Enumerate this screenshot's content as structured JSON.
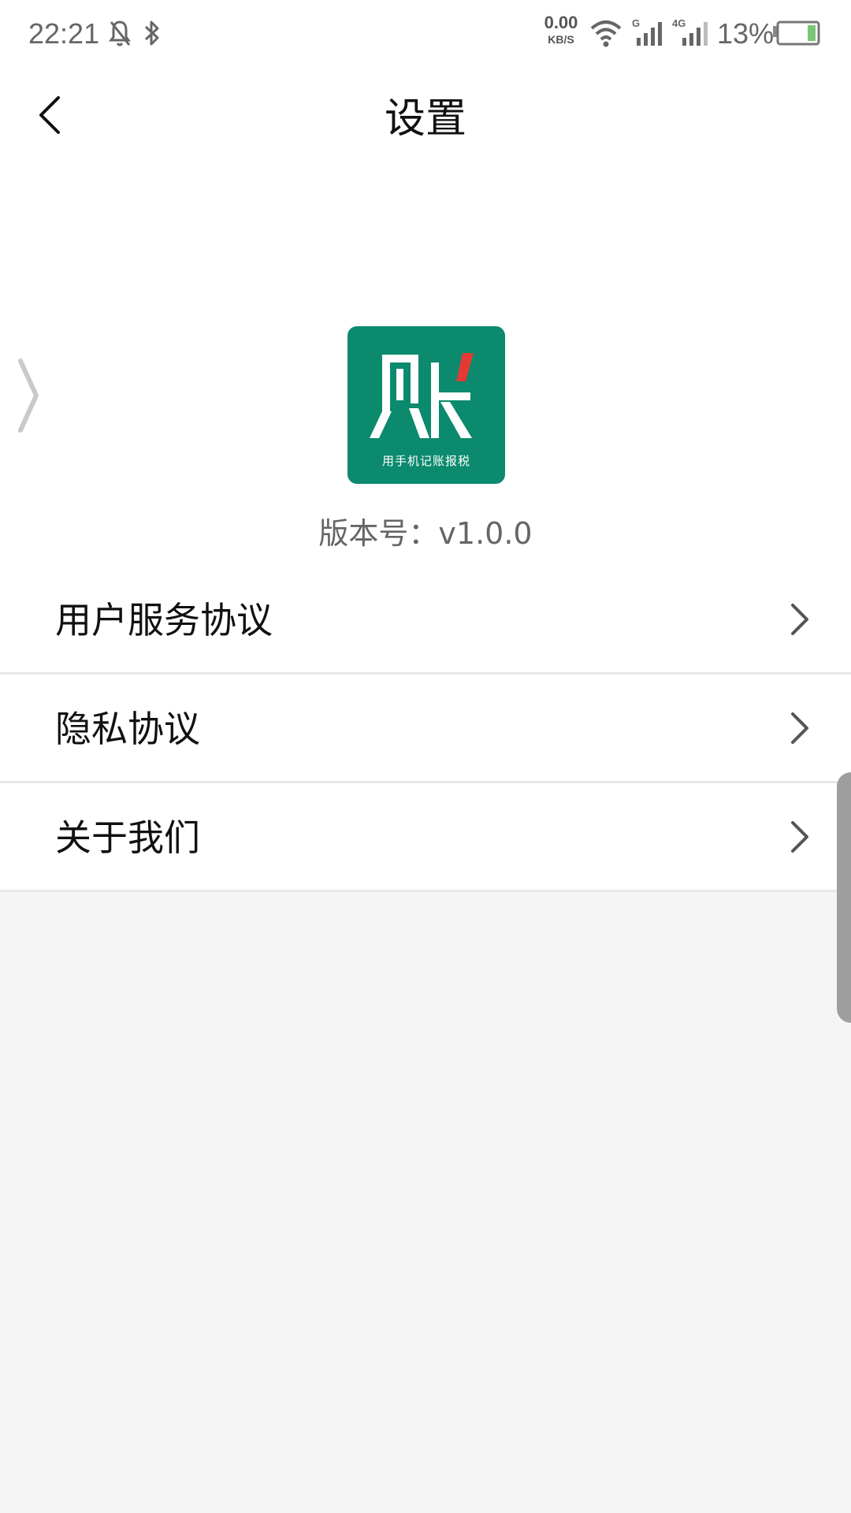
{
  "status_bar": {
    "time": "22:21",
    "net_speed_value": "0.00",
    "net_speed_unit": "KB/S",
    "sim1_label": "G",
    "sim2_label": "4G",
    "battery_percent": "13%",
    "battery_level": 0.13,
    "icons": [
      "mute-bell-icon",
      "bluetooth-icon",
      "wifi-icon",
      "signal-icon",
      "battery-icon"
    ]
  },
  "header": {
    "title": "设置",
    "back_icon": "chevron-left-icon"
  },
  "app": {
    "logo_char": "账",
    "logo_tagline": "用手机记账报税",
    "logo_color": "#0b8a6d",
    "logo_accent": "#e53935",
    "version": "版本号：v1.0.0"
  },
  "menu": {
    "items": [
      {
        "label": "用户服务协议",
        "icon": "chevron-right-icon"
      },
      {
        "label": "隐私协议",
        "icon": "chevron-right-icon"
      },
      {
        "label": "关于我们",
        "icon": "chevron-right-icon"
      }
    ]
  }
}
